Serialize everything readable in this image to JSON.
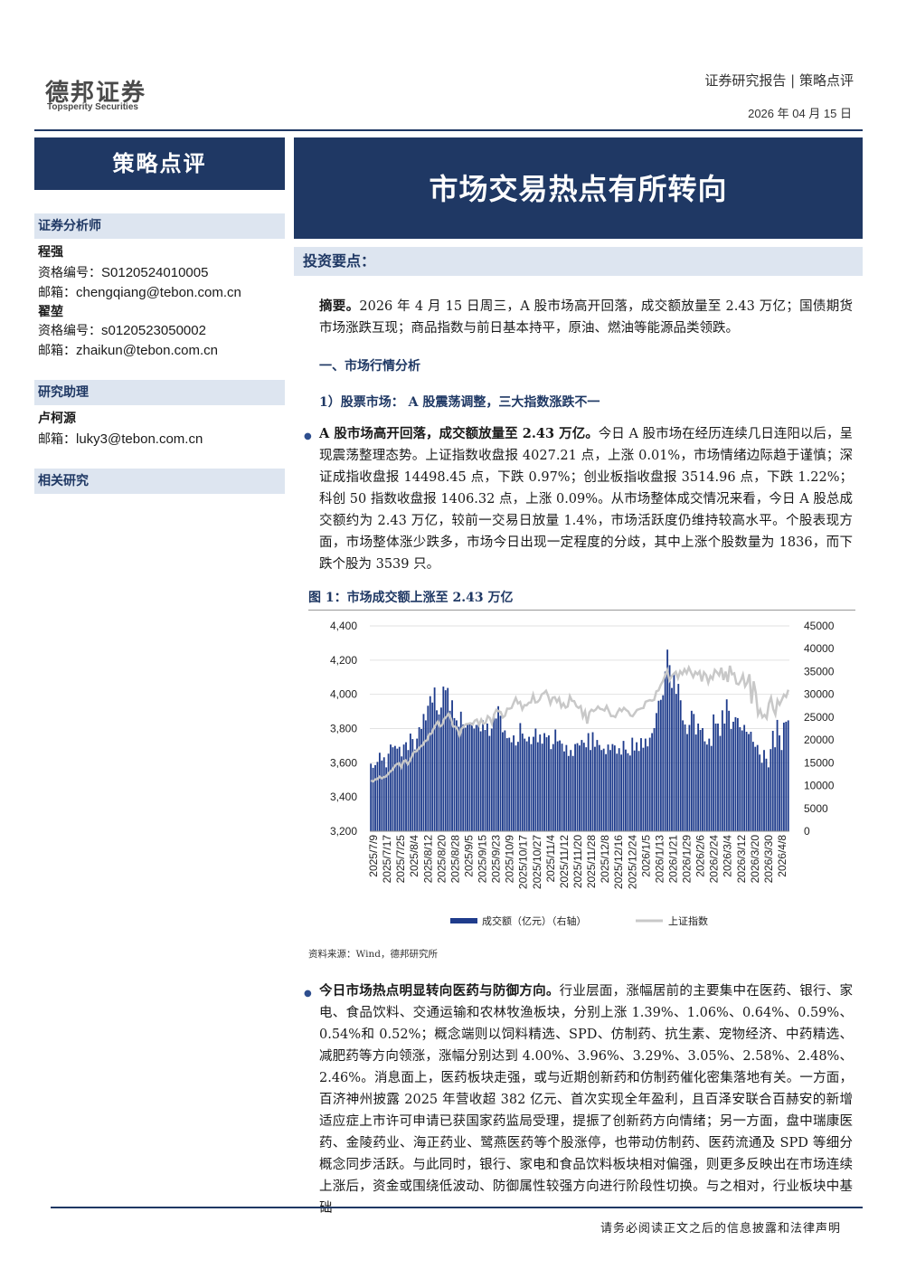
{
  "header": {
    "logo_cn": "德邦证券",
    "logo_en": "Topsperity Securities",
    "report_type": "证券研究报告 | 策略点评",
    "date": "2026 年 04 月 15 日"
  },
  "category": "策略点评",
  "title": "市场交易热点有所转向",
  "sidebar": {
    "analyst_head": "证券分析师",
    "analysts": [
      {
        "name": "程强",
        "cert_label": "资格编号：",
        "cert": "S0120524010005",
        "email_label": "邮箱：",
        "email": "chengqiang@tebon.com.cn"
      },
      {
        "name": "翟堃",
        "cert_label": "资格编号：",
        "cert": "s0120523050002",
        "email_label": "邮箱：",
        "email": "zhaikun@tebon.com.cn"
      }
    ],
    "assistant_head": "研究助理",
    "assistant": {
      "name": "卢柯源",
      "email_label": "邮箱：",
      "email": "luky3@tebon.com.cn"
    },
    "related_head": "相关研究"
  },
  "main": {
    "inv_head": "投资要点：",
    "abstract_lead": "摘要。",
    "abstract_body": "2026 年 4 月 15 日周三，A 股市场高开回落，成交额放量至 2.43 万亿；国债期货市场涨跌互现；商品指数与前日基本持平，原油、燃油等能源品类领跌。",
    "sec1": "一、市场行情分析",
    "sec1_1": "1）股票市场： A 股震荡调整，三大指数涨跌不一",
    "p1_lead": "A 股市场高开回落，成交额放量至 2.43 万亿。",
    "p1_body": "今日 A 股市场在经历连续几日连阳以后，呈现震荡整理态势。上证指数收盘报 4027.21 点，上涨 0.01%，市场情绪边际趋于谨慎；深证成指收盘报 14498.45 点，下跌 0.97%；创业板指收盘报 3514.96 点，下跌 1.22%；科创 50 指数收盘报 1406.32 点，上涨 0.09%。从市场整体成交情况来看，今日 A 股总成交额约为 2.43 万亿，较前一交易日放量 1.4%，市场活跃度仍维持较高水平。个股表现方面，市场整体涨少跌多，市场今日出现一定程度的分歧，其中上涨个股数量为 1836，而下跌个股为 3539 只。",
    "fig_title": "图 1：市场成交额上涨至 2.43 万亿",
    "source": "资料来源：Wind，德邦研究所",
    "p2_lead": "今日市场热点明显转向医药与防御方向。",
    "p2_body": "行业层面，涨幅居前的主要集中在医药、银行、家电、食品饮料、交通运输和农林牧渔板块，分别上涨 1.39%、1.06%、0.64%、0.59%、0.54%和 0.52%；概念端则以饲料精选、SPD、仿制药、抗生素、宠物经济、中药精选、减肥药等方向领涨，涨幅分别达到 4.00%、3.96%、3.29%、3.05%、2.58%、2.48%、2.46%。消息面上，医药板块走强，或与近期创新药和仿制药催化密集落地有关。一方面，百济神州披露 2025 年营收超 382 亿元、首次实现全年盈利，且百泽安联合百赫安的新增适应症上市许可申请已获国家药监局受理，提振了创新药方向情绪；另一方面，盘中瑞康医药、金陵药业、海正药业、鹭燕医药等个股涨停，也带动仿制药、医药流通及 SPD 等细分概念同步活跃。与此同时，银行、家电和食品饮料板块相对偏强，则更多反映出在市场连续上涨后，资金或围绕低波动、防御属性较强方向进行阶段性切换。与之相对，行业板块中基础"
  },
  "footer": "请务必阅读正文之后的信息披露和法律声明",
  "chart_data": {
    "type": "bar+line",
    "title": "图 1：市场成交额上涨至 2.43 万亿",
    "y_left_lim": [
      3200,
      4400
    ],
    "y_left_ticks": [
      "3,200",
      "3,400",
      "3,600",
      "3,800",
      "4,000",
      "4,200",
      "4,400"
    ],
    "y_right_lim": [
      0,
      45000
    ],
    "y_right_ticks": [
      "0",
      "5000",
      "10000",
      "15000",
      "20000",
      "25000",
      "30000",
      "35000",
      "40000",
      "45000"
    ],
    "x_ticks": [
      "2025/7/9",
      "2025/7/17",
      "2025/7/25",
      "2025/8/4",
      "2025/8/12",
      "2025/8/20",
      "2025/8/28",
      "2025/9/5",
      "2025/9/15",
      "2025/9/23",
      "2025/10/9",
      "2025/10/17",
      "2025/10/27",
      "2025/11/4",
      "2025/11/12",
      "2025/11/20",
      "2025/11/28",
      "2025/12/8",
      "2025/12/16",
      "2025/12/24",
      "2026/1/5",
      "2026/1/13",
      "2026/1/21",
      "2026/1/29",
      "2026/2/6",
      "2026/2/24",
      "2026/3/4",
      "2026/3/12",
      "2026/3/20",
      "2026/3/30",
      "2026/4/8"
    ],
    "series": [
      {
        "name": "成交额（亿元）（右轴）",
        "axis": "right",
        "color": "#1f3c8c",
        "values": [
          14800,
          13900,
          14500,
          15200,
          17200,
          15500,
          16200,
          14000,
          17000,
          19000,
          18400,
          18700,
          18100,
          18500,
          16400,
          19000,
          19500,
          17800,
          21400,
          20200,
          17900,
          20300,
          22800,
          22400,
          25700,
          24300,
          27500,
          29600,
          28200,
          31500,
          26500,
          25600,
          27100,
          31700,
          30900,
          31400,
          26400,
          28700,
          24800,
          24300,
          22900,
          26200,
          23400,
          22700,
          23400,
          23700,
          23800,
          22500,
          23300,
          23500,
          21900,
          24300,
          22200,
          23600,
          20900,
          22500,
          25700,
          24700,
          27400,
          25300,
          21700,
          22100,
          20400,
          20500,
          19500,
          21000,
          18800,
          19600,
          23700,
          21400,
          20300,
          19700,
          20700,
          19100,
          20700,
          22500,
          19500,
          21200,
          19200,
          21500,
          20600,
          21000,
          18000,
          19100,
          22300,
          19700,
          19900,
          19200,
          17500,
          18900,
          16500,
          17800,
          16500,
          19100,
          19300,
          18800,
          20000,
          19400,
          18400,
          21500,
          17800,
          21700,
          18500,
          20000,
          18900,
          17800,
          18100,
          16900,
          19000,
          17800,
          19100,
          18800,
          17000,
          18200,
          16800,
          19800,
          17900,
          17100,
          16600,
          20500,
          17700,
          19500,
          17600,
          20400,
          18300,
          20300,
          18600,
          20500,
          21500,
          22600,
          25900,
          28600,
          28800,
          29800,
          35000,
          39800,
          36400,
          31400,
          34400,
          30100,
          32300,
          28700,
          24300,
          23400,
          21300,
          23300,
          26400,
          25700,
          21200,
          23600,
          22200,
          22600,
          19700,
          19000,
          20300,
          18700,
          25600,
          23600,
          23600,
          20900,
          26500,
          23600,
          28900,
          26400,
          22400,
          24000,
          25000,
          24800,
          22800,
          22100,
          23300,
          21800,
          21300,
          21800,
          19600,
          18500,
          18900,
          16800,
          15000,
          17800,
          15900,
          14000,
          18000,
          22000,
          18400,
          24400,
          21000,
          17800,
          23800,
          24000,
          24300
        ],
        "note": "成交额（亿元）（右轴）"
      },
      {
        "name": "上证指数",
        "axis": "left",
        "color": "#c8c8c8",
        "values": [
          3496,
          3492,
          3503,
          3505,
          3519,
          3510,
          3516,
          3520,
          3535,
          3550,
          3559,
          3581,
          3593,
          3597,
          3573,
          3608,
          3615,
          3592,
          3610,
          3639,
          3665,
          3666,
          3681,
          3696,
          3704,
          3727,
          3732,
          3768,
          3771,
          3800,
          3823,
          3842,
          3812,
          3822,
          3858,
          3870,
          3888,
          3858,
          3812,
          3812,
          3795,
          3760,
          3800,
          3814,
          3826,
          3828,
          3831,
          3822,
          3846,
          3853,
          3821,
          3853,
          3829,
          3833,
          3873,
          3862,
          3828,
          3883,
          3910,
          3902,
          3897,
          3865,
          3875,
          3917,
          3916,
          3920,
          3951,
          3979,
          3947,
          3956,
          3912,
          3937,
          3936,
          3951,
          3953,
          3999,
          3953,
          3955,
          3969,
          4000,
          4008,
          4021,
          3990,
          3945,
          3980,
          3984,
          3956,
          3978,
          3926,
          3947,
          3922,
          3929,
          3990,
          3962,
          3960,
          3931,
          3921,
          3931,
          3868,
          3901,
          3829,
          3895,
          3910,
          3902,
          3911,
          3929,
          3915,
          3912,
          3905,
          3932,
          3903,
          3873,
          3874,
          3867,
          3895,
          3916,
          3902,
          3921,
          3909,
          3900,
          3876,
          3872,
          3890,
          3909,
          3913,
          3918,
          3920,
          3957,
          3962,
          3966,
          3963,
          3968,
          4018,
          4023,
          4055,
          4077,
          4111,
          4141,
          4082,
          4105,
          4120,
          4132,
          4095,
          4135,
          4117,
          4146,
          4123,
          4157,
          4128,
          4101,
          4131,
          4117,
          4134,
          4076,
          4129,
          4113,
          4067,
          4107,
          4090,
          4143,
          4129,
          4111,
          4156,
          4084,
          4133,
          4073,
          4167,
          4117,
          4123,
          4063,
          4058,
          4080,
          4115,
          4047,
          4069,
          4117,
          3947,
          4076,
          4007,
          3881,
          3910,
          3866,
          3880,
          3860,
          3947,
          3982,
          3914,
          3882,
          3966,
          3940,
          3968,
          3998,
          3985,
          4027
        ]
      }
    ],
    "legend_position": "bottom",
    "legend": [
      "成交额（亿元）（右轴）",
      "上证指数"
    ]
  }
}
